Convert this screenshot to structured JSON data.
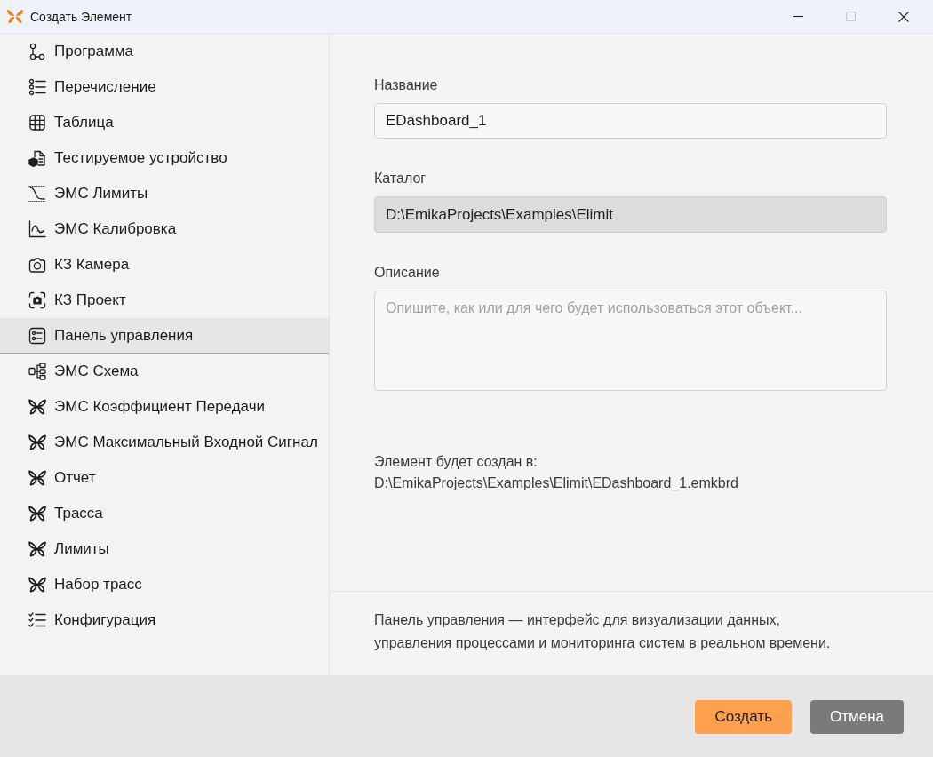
{
  "window": {
    "title": "Создать Элемент",
    "controls": [
      {
        "kind": "minimize",
        "disabled": false
      },
      {
        "kind": "maximize",
        "disabled": true
      },
      {
        "kind": "close",
        "disabled": false
      }
    ]
  },
  "sidebar": {
    "items": [
      {
        "label": "Программа",
        "kind": "flow",
        "selected": false
      },
      {
        "label": "Перечисление",
        "kind": "list",
        "selected": false
      },
      {
        "label": "Таблица",
        "kind": "grid",
        "selected": false
      },
      {
        "label": "Тестируемое устройство",
        "kind": "device",
        "selected": false
      },
      {
        "label": "ЭМС Лимиты",
        "kind": "limit",
        "selected": false
      },
      {
        "label": "ЭМС Калибровка",
        "kind": "calibration",
        "selected": false
      },
      {
        "label": "КЗ Камера",
        "kind": "camera",
        "selected": false
      },
      {
        "label": "КЗ Проект",
        "kind": "capture",
        "selected": false
      },
      {
        "label": "Панель управления",
        "kind": "dashboard",
        "selected": true
      },
      {
        "label": "ЭМС Схема",
        "kind": "schema",
        "selected": false
      },
      {
        "label": "ЭМС Коэффициент Передачи",
        "kind": "module",
        "selected": false
      },
      {
        "label": "ЭМС Максимальный Входной Сигнал",
        "kind": "module",
        "selected": false
      },
      {
        "label": "Отчет",
        "kind": "module",
        "selected": false
      },
      {
        "label": "Трасса",
        "kind": "module",
        "selected": false
      },
      {
        "label": "Лимиты",
        "kind": "module",
        "selected": false
      },
      {
        "label": "Набор трасс",
        "kind": "module",
        "selected": false
      },
      {
        "label": "Конфигурация",
        "kind": "checklist",
        "selected": false
      }
    ]
  },
  "form": {
    "fields": [
      {
        "label": "Название",
        "kind": "input",
        "value": "EDashboard_1",
        "disabled": false
      },
      {
        "label": "Каталог",
        "kind": "input",
        "value": "D:\\EmikaProjects\\Examples\\Elimit",
        "disabled": true
      },
      {
        "label": "Описание",
        "kind": "textarea",
        "placeholder": "Опишите, как или для чего будет использоваться этот объект...",
        "disabled": false
      }
    ],
    "target": {
      "label": "Элемент будет создан в:",
      "path": "D:\\EmikaProjects\\Examples\\Elimit\\EDashboard_1.emkbrd"
    }
  },
  "info": {
    "lines": [
      "Панель управления — интерфейс для визуализации данных,",
      "управления процессами и мониторинга систем в реальном времени."
    ]
  },
  "footer": {
    "buttons": [
      {
        "label": "Создать",
        "kind": "primary"
      },
      {
        "label": "Отмена",
        "kind": "secondary"
      }
    ]
  }
}
